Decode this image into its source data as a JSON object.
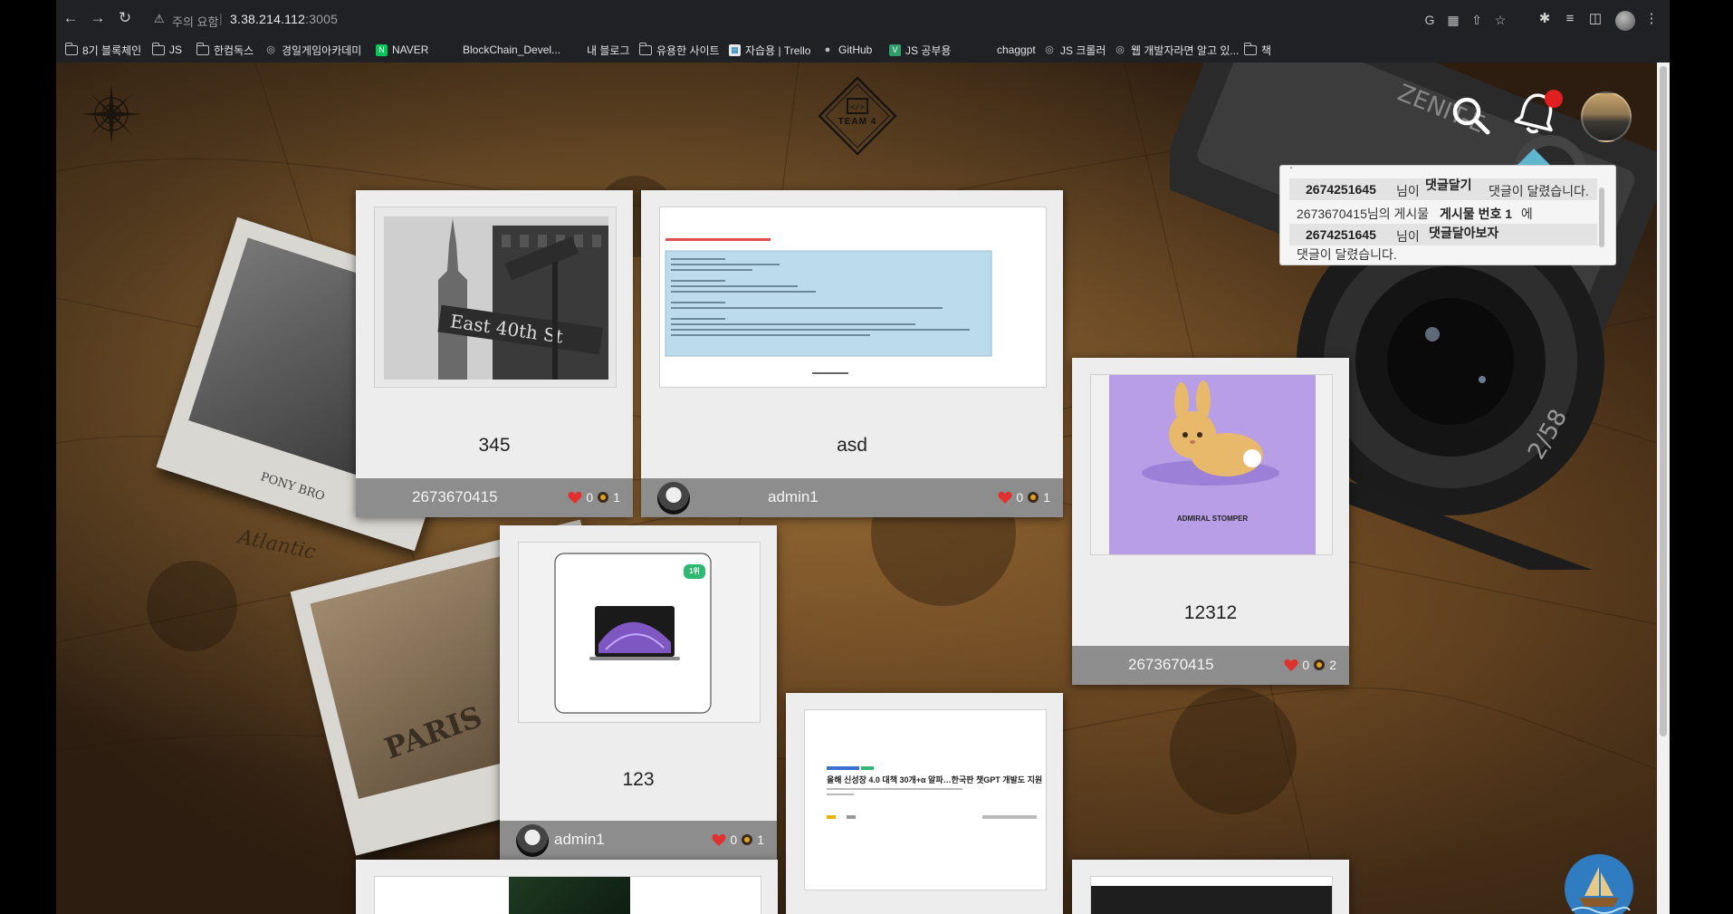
{
  "browser": {
    "security_label": "주의 요함",
    "host": "3.38.214.112",
    "port": ":3005",
    "bookmarks": [
      {
        "label": "8기 블록체인",
        "icon": "folder-icon"
      },
      {
        "label": "JS",
        "icon": "folder-icon"
      },
      {
        "label": "한컴독스",
        "icon": "folder-icon"
      },
      {
        "label": "경일게임아카데미",
        "icon": "globe-icon"
      },
      {
        "label": "NAVER",
        "icon": "naver-icon"
      },
      {
        "label": "BlockChain_Devel...",
        "icon": "page-icon"
      },
      {
        "label": "내 블로그",
        "icon": "page-icon"
      },
      {
        "label": "유용한 사이트",
        "icon": "folder-icon"
      },
      {
        "label": "자습용 | Trello",
        "icon": "trello-icon"
      },
      {
        "label": "GitHub",
        "icon": "github-icon"
      },
      {
        "label": "JS 공부용",
        "icon": "vue-icon"
      },
      {
        "label": "chaggpt",
        "icon": "page-icon"
      },
      {
        "label": "JS 크롤러",
        "icon": "globe-icon"
      },
      {
        "label": "웹 개발자라면 알고 있...",
        "icon": "globe-icon"
      },
      {
        "label": "책",
        "icon": "folder-icon"
      }
    ]
  },
  "header": {
    "logo_text": "TEAM 4"
  },
  "notifications": {
    "items": [
      {
        "user": "2674251645",
        "mid": "님이",
        "tag": "댓글달기",
        "end": "댓글이 달렸습니다."
      },
      {
        "prefix": "2673670415님의 게시물",
        "post": "게시물 번호 1",
        "post_suffix": "에",
        "user": "2674251645",
        "mid": "님이",
        "tag": "댓글달아보자",
        "end": "댓글이 달렸습니다."
      }
    ]
  },
  "posts": [
    {
      "title": "345",
      "author": "2673670415",
      "likes": "0",
      "views": "1"
    },
    {
      "title": "asd",
      "author": "admin1",
      "likes": "0",
      "views": "1"
    },
    {
      "title": "12312",
      "author": "2673670415",
      "likes": "0",
      "views": "2",
      "image_caption": "ADMIRAL STOMPER"
    },
    {
      "title": "123",
      "author": "admin1",
      "likes": "0",
      "views": "1",
      "badge": "1위"
    },
    {
      "title": "",
      "author": "",
      "likes": "",
      "views": "",
      "headline": "올해 신성장 4.0 대책 30개+α 알파…한국판 챗GPT 개발도 지원"
    }
  ],
  "polaroids": {
    "top_caption": "PONY BRO",
    "bottom_caption": "PARIS"
  },
  "colors": {
    "chrome_bg": "#202124",
    "card_bg": "#ededed",
    "card_footer": "#8d8d8d",
    "heart": "#e0312f",
    "notification_dot": "#e02020"
  }
}
